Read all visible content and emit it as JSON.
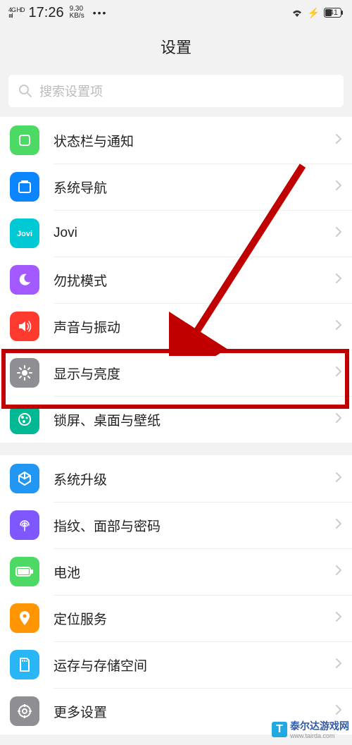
{
  "status_bar": {
    "network_type": "4G HD",
    "time": "17:26",
    "speed_up": "9.30",
    "speed_unit": "KB/s",
    "dots": "•••",
    "battery": "41"
  },
  "header": {
    "title": "设置"
  },
  "search": {
    "placeholder": "搜索设置项"
  },
  "icons": {
    "status_notif": "status-icon",
    "nav": "nav-icon",
    "jovi": "jovi-icon",
    "dnd": "moon-icon",
    "sound": "speaker-icon",
    "display": "brightness-icon",
    "lock": "palette-icon",
    "upgrade": "cube-icon",
    "biometric": "fingerprint-icon",
    "battery": "battery-icon",
    "location": "pin-icon",
    "storage": "sd-icon",
    "more": "gear-icon"
  },
  "colors": {
    "status_notif": "#4cd964",
    "nav": "#0a84ff",
    "jovi": "#00c9d6",
    "dnd": "#a259ff",
    "sound": "#ff3b30",
    "display": "#8e8e93",
    "lock": "#00b894",
    "upgrade": "#2196f3",
    "biometric": "#7e57ff",
    "battery": "#4cd964",
    "location": "#ff9500",
    "storage": "#29b6f6",
    "more": "#8e8e93"
  },
  "sections": [
    {
      "items": [
        {
          "key": "status_notif",
          "label": "状态栏与通知"
        },
        {
          "key": "nav",
          "label": "系统导航"
        },
        {
          "key": "jovi",
          "label": "Jovi"
        },
        {
          "key": "dnd",
          "label": "勿扰模式"
        },
        {
          "key": "sound",
          "label": "声音与振动"
        },
        {
          "key": "display",
          "label": "显示与亮度"
        },
        {
          "key": "lock",
          "label": "锁屏、桌面与壁纸"
        }
      ]
    },
    {
      "items": [
        {
          "key": "upgrade",
          "label": "系统升级"
        },
        {
          "key": "biometric",
          "label": "指纹、面部与密码"
        },
        {
          "key": "battery",
          "label": "电池"
        },
        {
          "key": "location",
          "label": "定位服务"
        },
        {
          "key": "storage",
          "label": "运存与存储空间"
        },
        {
          "key": "more",
          "label": "更多设置"
        }
      ]
    }
  ],
  "annotation": {
    "highlight_target": "display"
  },
  "watermark": {
    "logo": "T",
    "name": "泰尔达游戏网",
    "url": "www.tairda.com"
  }
}
